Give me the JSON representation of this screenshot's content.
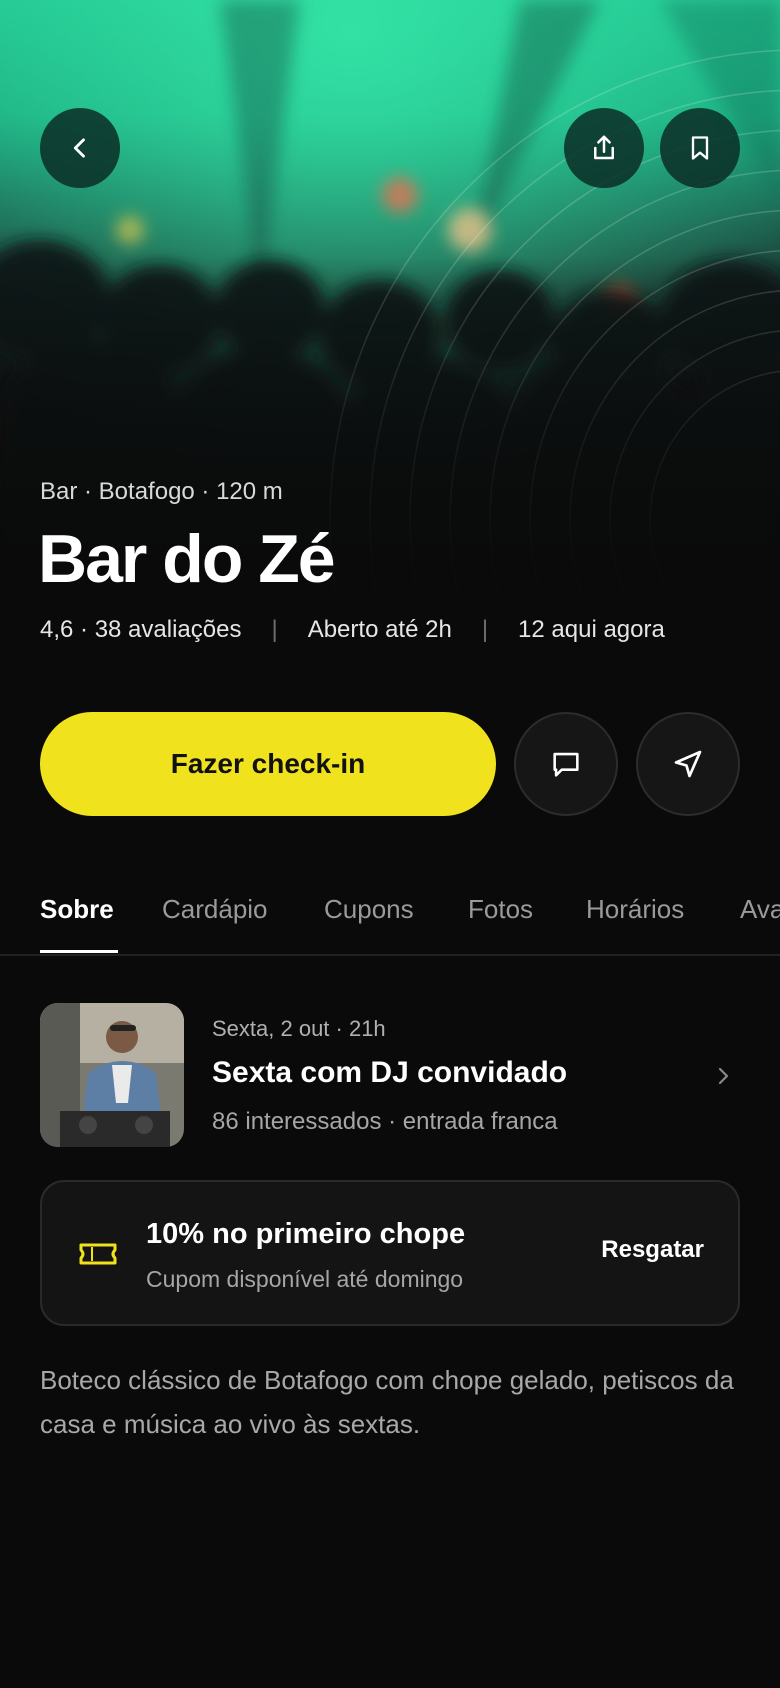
{
  "venue": {
    "subtitle": "Bar · Botafogo · 120 m",
    "name": "Bar do Zé",
    "rating": "4,6 · 38 avaliações",
    "hours": "Aberto até 2h",
    "present": "12 aqui agora",
    "separator": "|"
  },
  "actions": {
    "checkin_label": "Fazer check-in",
    "back_icon": "chevron-left-icon",
    "share_icon": "share-icon",
    "bookmark_icon": "bookmark-icon",
    "chat_icon": "chat-icon",
    "directions_icon": "navigation-arrow-icon"
  },
  "tabs": [
    "Sobre",
    "Cardápio",
    "Cupons",
    "Fotos",
    "Horários",
    "Avaliações"
  ],
  "active_tab": "Sobre",
  "event": {
    "date": "Sexta, 2 out · 21h",
    "title": "Sexta com DJ convidado",
    "details": "86 interessados · entrada franca"
  },
  "coupon": {
    "title": "10% no primeiro chope",
    "subtitle": "Cupom disponível até domingo",
    "action": "Resgatar",
    "icon": "ticket-icon"
  },
  "description": "Boteco clássico de Botafogo com chope gelado, petiscos da casa e música ao vivo às sextas.",
  "colors": {
    "accent": "#f0e31d",
    "background": "#0a0a0a",
    "hero_green": "#1fbf8c"
  }
}
